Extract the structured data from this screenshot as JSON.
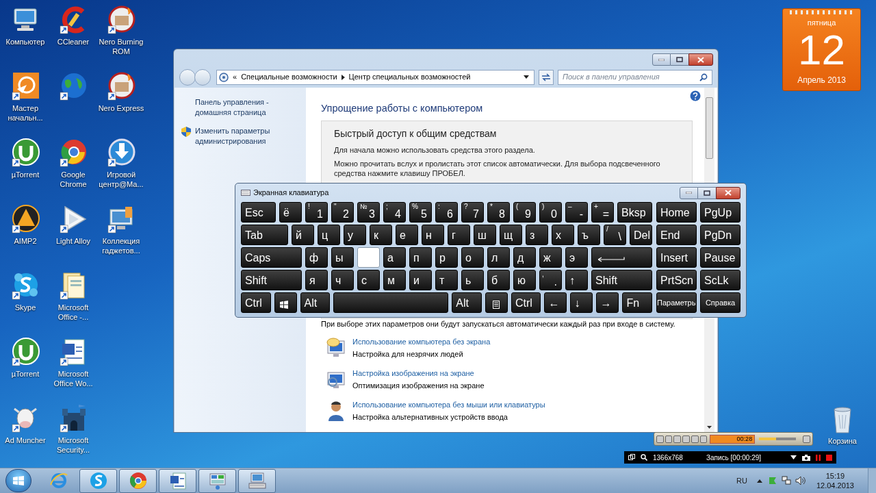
{
  "desktop_icons": [
    {
      "label": "Компьютер",
      "kind": "system"
    },
    {
      "label": "Мастер начальн...",
      "kind": "shortcut"
    },
    {
      "label": "µTorrent",
      "kind": "shortcut"
    },
    {
      "label": "AIMP2",
      "kind": "shortcut"
    },
    {
      "label": "Skype",
      "kind": "shortcut"
    },
    {
      "label": "µTorrent",
      "kind": "shortcut"
    },
    {
      "label": "Ad Muncher",
      "kind": "shortcut"
    },
    {
      "label": "CCleaner",
      "kind": "shortcut"
    },
    {
      "kind": "shortcut"
    },
    {
      "label": "Google Chrome",
      "kind": "shortcut"
    },
    {
      "label": "Light Alloy",
      "kind": "shortcut"
    },
    {
      "label": "Microsoft Office -...",
      "kind": "shortcut"
    },
    {
      "label": "Microsoft Office Wo...",
      "kind": "shortcut"
    },
    {
      "label": "Microsoft Security...",
      "kind": "shortcut"
    },
    {
      "label": "Nero Burning ROM",
      "kind": "shortcut"
    },
    {
      "label": "Nero Express",
      "kind": "shortcut"
    },
    {
      "label": "Игровой центр@Ма...",
      "kind": "shortcut"
    },
    {
      "label": "Коллекция гаджетов...",
      "kind": "shortcut"
    }
  ],
  "recycle_bin": {
    "label": "Корзина"
  },
  "calendar": {
    "weekday": "пятница",
    "day": "12",
    "month_year": "Апрель 2013"
  },
  "control_panel": {
    "address_prefix": "«",
    "address": [
      "Специальные возможности",
      "Центр специальных возможностей"
    ],
    "search": {
      "placeholder": "Поиск в панели управления"
    },
    "side_links": [
      {
        "text": "Панель управления - домашняя страница",
        "kind": "plain"
      },
      {
        "text": "Изменить параметры администрирования",
        "kind": "shield"
      }
    ],
    "heading": "Упрощение работы с компьютером",
    "quick_access": {
      "title": "Быстрый доступ к общим средствам",
      "lines": [
        "Для начала можно использовать средства этого раздела.",
        "Можно прочитать вслух и пролистать этот список автоматически. Для выбора подсвеченного средства нажмите клавишу ПРОБЕЛ."
      ]
    },
    "note": "При выборе этих параметров они будут запускаться автоматически каждый раз при входе в систему.",
    "items": [
      {
        "link": "Использование компьютера без экрана",
        "description": "Настройка для незрячих людей"
      },
      {
        "link": "Настройка изображения на экране",
        "description": "Оптимизация изображения на экране"
      },
      {
        "link": "Использование компьютера без мыши или клавиатуры",
        "description": "Настройка альтернативных устройств ввода"
      }
    ]
  },
  "keyboard": {
    "title": "Экранная клавиатура",
    "rows": [
      {
        "keys": [
          {
            "label": "Esc",
            "kind": "mod",
            "selected": false
          },
          {
            "label": "ё",
            "kind": "char",
            "selected": false
          },
          {
            "label": "1",
            "shift": "!",
            "kind": "char",
            "selected": false
          },
          {
            "label": "2",
            "shift": "\"",
            "kind": "char",
            "selected": false
          },
          {
            "label": "3",
            "shift": "№",
            "kind": "char",
            "selected": false
          },
          {
            "label": "4",
            "shift": ";",
            "kind": "char",
            "selected": false
          },
          {
            "label": "5",
            "shift": "%",
            "kind": "char",
            "selected": false
          },
          {
            "label": "6",
            "shift": ":",
            "kind": "char",
            "selected": false
          },
          {
            "label": "7",
            "shift": "?",
            "kind": "char",
            "selected": false
          },
          {
            "label": "8",
            "shift": "*",
            "kind": "char",
            "selected": false
          },
          {
            "label": "9",
            "shift": "(",
            "kind": "char",
            "selected": false
          },
          {
            "label": "0",
            "shift": ")",
            "kind": "char",
            "selected": false
          },
          {
            "label": "-",
            "shift": "–",
            "kind": "char",
            "selected": false
          },
          {
            "label": "=",
            "shift": "+",
            "kind": "char",
            "selected": false
          },
          {
            "label": "Bksp",
            "kind": "mod",
            "selected": false
          }
        ]
      },
      {
        "keys": [
          {
            "label": "Tab",
            "kind": "mod",
            "selected": false
          },
          {
            "label": "й",
            "kind": "char",
            "selected": false
          },
          {
            "label": "ц",
            "kind": "char",
            "selected": false
          },
          {
            "label": "у",
            "kind": "char",
            "selected": false
          },
          {
            "label": "к",
            "kind": "char",
            "selected": false
          },
          {
            "label": "е",
            "kind": "char",
            "selected": false
          },
          {
            "label": "н",
            "kind": "char",
            "selected": false
          },
          {
            "label": "г",
            "kind": "char",
            "selected": false
          },
          {
            "label": "ш",
            "kind": "char",
            "selected": false
          },
          {
            "label": "щ",
            "kind": "char",
            "selected": false
          },
          {
            "label": "з",
            "kind": "char",
            "selected": false
          },
          {
            "label": "х",
            "kind": "char",
            "selected": false
          },
          {
            "label": "ъ",
            "kind": "char",
            "selected": false
          },
          {
            "label": "\\",
            "shift": "/",
            "kind": "char",
            "selected": false
          },
          {
            "label": "Del",
            "kind": "char",
            "selected": false
          }
        ]
      },
      {
        "keys": [
          {
            "label": "Caps",
            "kind": "mod",
            "selected": false
          },
          {
            "label": "ф",
            "kind": "char",
            "selected": false
          },
          {
            "label": "ы",
            "kind": "char",
            "selected": false
          },
          {
            "kind": "char",
            "selected": true
          },
          {
            "label": "а",
            "kind": "char",
            "selected": false
          },
          {
            "label": "п",
            "kind": "char",
            "selected": false
          },
          {
            "label": "р",
            "kind": "char",
            "selected": false
          },
          {
            "label": "о",
            "kind": "char",
            "selected": false
          },
          {
            "label": "л",
            "kind": "char",
            "selected": false
          },
          {
            "label": "д",
            "kind": "char",
            "selected": false
          },
          {
            "label": "ж",
            "kind": "char",
            "selected": false
          },
          {
            "label": "э",
            "kind": "char",
            "selected": false
          },
          {
            "kind": "enter",
            "selected": false
          }
        ]
      },
      {
        "keys": [
          {
            "label": "Shift",
            "kind": "mod",
            "selected": false
          },
          {
            "label": "я",
            "kind": "char",
            "selected": false
          },
          {
            "label": "ч",
            "kind": "char",
            "selected": false
          },
          {
            "label": "с",
            "kind": "char",
            "selected": false
          },
          {
            "label": "м",
            "kind": "char",
            "selected": false
          },
          {
            "label": "и",
            "kind": "char",
            "selected": false
          },
          {
            "label": "т",
            "kind": "char",
            "selected": false
          },
          {
            "label": "ь",
            "kind": "char",
            "selected": false
          },
          {
            "label": "б",
            "kind": "char",
            "selected": false
          },
          {
            "label": "ю",
            "kind": "char",
            "selected": false
          },
          {
            "label": ".",
            "shift": ",",
            "kind": "char",
            "selected": false
          },
          {
            "label": "↑",
            "kind": "char",
            "selected": false
          },
          {
            "label": "Shift",
            "kind": "mod",
            "selected": false
          }
        ]
      },
      {
        "keys": [
          {
            "label": "Ctrl",
            "kind": "mod",
            "selected": false
          },
          {
            "kind": "win",
            "selected": false
          },
          {
            "label": "Alt",
            "kind": "mod",
            "selected": false
          },
          {
            "kind": "space",
            "selected": false
          },
          {
            "label": "Alt",
            "kind": "mod",
            "selected": false
          },
          {
            "kind": "menu",
            "selected": false
          },
          {
            "label": "Ctrl",
            "kind": "mod",
            "selected": false
          },
          {
            "label": "←",
            "kind": "char",
            "selected": false
          },
          {
            "label": "↓",
            "kind": "char",
            "selected": false
          },
          {
            "label": "→",
            "kind": "char",
            "selected": false
          },
          {
            "label": "Fn",
            "kind": "mod",
            "selected": false
          }
        ]
      }
    ],
    "nav_rows": [
      {
        "keys": [
          {
            "label": "Home",
            "kind": "mod",
            "selected": false
          },
          {
            "label": "PgUp",
            "kind": "mod",
            "selected": false
          }
        ]
      },
      {
        "keys": [
          {
            "label": "End",
            "kind": "mod",
            "selected": false
          },
          {
            "label": "PgDn",
            "kind": "mod",
            "selected": false
          }
        ]
      },
      {
        "keys": [
          {
            "label": "Insert",
            "kind": "mod",
            "selected": false
          },
          {
            "label": "Pause",
            "kind": "mod",
            "selected": false
          }
        ]
      },
      {
        "keys": [
          {
            "label": "PrtScn",
            "kind": "mod",
            "selected": false
          },
          {
            "label": "ScLk",
            "kind": "mod",
            "selected": false
          }
        ]
      },
      {
        "keys": [
          {
            "label": "Параметры",
            "kind": "small",
            "selected": false
          },
          {
            "label": "Справка",
            "kind": "small",
            "selected": false
          }
        ]
      }
    ]
  },
  "player": {
    "time": "00:28",
    "level": 0.45
  },
  "recorder": {
    "resolution": "1366x768",
    "status": "Запись [00:00:29]"
  },
  "taskbar": {
    "apps": [
      {
        "running": false
      },
      {
        "running": true
      },
      {
        "running": true
      },
      {
        "running": true
      },
      {
        "running": true
      },
      {
        "running": true
      }
    ],
    "language": "RU",
    "time": "15:19",
    "date": "12.04.2013"
  }
}
